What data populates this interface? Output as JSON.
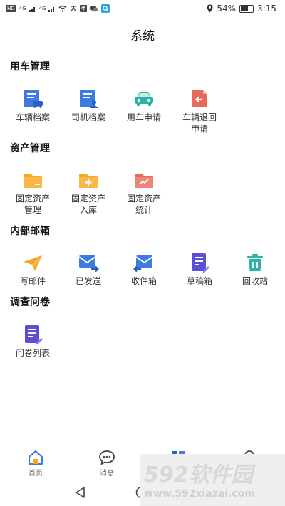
{
  "status_bar": {
    "left_chips": [
      "HD",
      "4G",
      "4G"
    ],
    "battery": "54%",
    "battery_fraction": 0.54,
    "time": "3:15"
  },
  "page": {
    "title": "系统"
  },
  "sections": {
    "vehicle": {
      "title": "用车管理",
      "items": [
        {
          "label_line1": "车辆档案",
          "label_line2": "",
          "icon": "car-file-icon",
          "color": "#3d7be0"
        },
        {
          "label_line1": "司机档案",
          "label_line2": "",
          "icon": "driver-file-icon",
          "color": "#3d7be0"
        },
        {
          "label_line1": "用车申请",
          "label_line2": "",
          "icon": "car-icon",
          "color": "#2bb3a8"
        },
        {
          "label_line1": "车辆退回",
          "label_line2": "申请",
          "icon": "return-icon",
          "color": "#e86a5b"
        }
      ]
    },
    "assets": {
      "title": "资产管理",
      "items": [
        {
          "label_line1": "固定资产",
          "label_line2": "管理",
          "icon": "folder-icon",
          "color": "#f5a623"
        },
        {
          "label_line1": "固定资产",
          "label_line2": "入库",
          "icon": "folder-add-icon",
          "color": "#f5a623"
        },
        {
          "label_line1": "固定资产",
          "label_line2": "统计",
          "icon": "folder-chart-icon",
          "color": "#e86a5b"
        }
      ]
    },
    "mail": {
      "title": "内部邮箱",
      "items": [
        {
          "label_line1": "写邮件",
          "label_line2": "",
          "icon": "send-icon",
          "color": "#f5a623"
        },
        {
          "label_line1": "已发送",
          "label_line2": "",
          "icon": "mail-sent-icon",
          "color": "#3d7be0"
        },
        {
          "label_line1": "收件箱",
          "label_line2": "",
          "icon": "inbox-icon",
          "color": "#3d7be0"
        },
        {
          "label_line1": "草稿箱",
          "label_line2": "",
          "icon": "draft-icon",
          "color": "#5b4fd6"
        },
        {
          "label_line1": "回收站",
          "label_line2": "",
          "icon": "trash-icon",
          "color": "#2bb3a8"
        }
      ]
    },
    "survey": {
      "title": "调查问卷",
      "items": [
        {
          "label_line1": "问卷列表",
          "label_line2": "",
          "icon": "survey-list-icon",
          "color": "#5b4fd6"
        }
      ]
    }
  },
  "bottom_nav": {
    "home": "首页",
    "messages": "消息",
    "accent": "#3d7be0"
  },
  "watermark": {
    "main": "592软件园",
    "url": "www.592xiazai.com"
  }
}
